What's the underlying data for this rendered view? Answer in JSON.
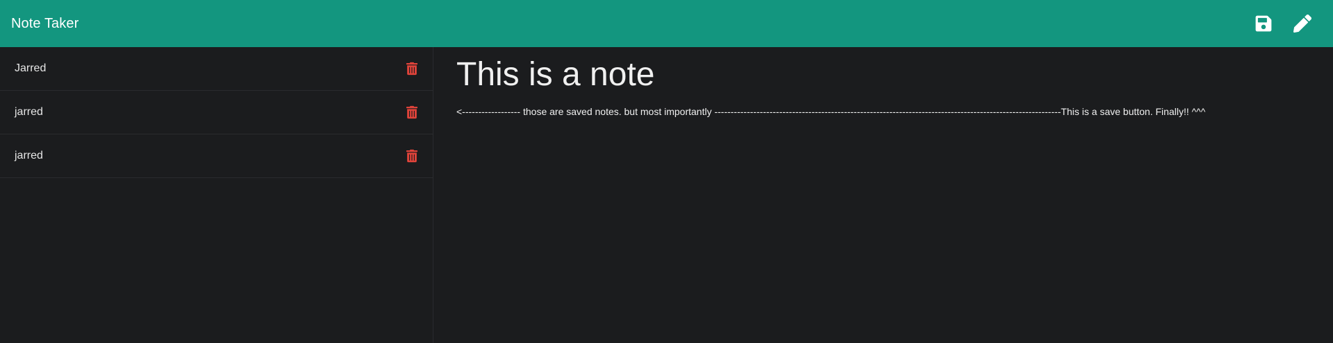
{
  "navbar": {
    "brand": "Note Taker",
    "icons": [
      "save-icon",
      "pencil-icon"
    ]
  },
  "sidebar": {
    "notes": [
      {
        "title": "Jarred"
      },
      {
        "title": "jarred"
      },
      {
        "title": "jarred"
      }
    ]
  },
  "editor": {
    "title": "This is a note",
    "body": "<------------------ those are saved notes.  but most importantly -----------------------------------------------------------------------------------------------------------This is a save button. Finally!! ^^^"
  },
  "colors": {
    "navbar": "#13967f",
    "background": "#1b1c1e",
    "delete": "#e0433a",
    "text": "#f0f0f0"
  }
}
